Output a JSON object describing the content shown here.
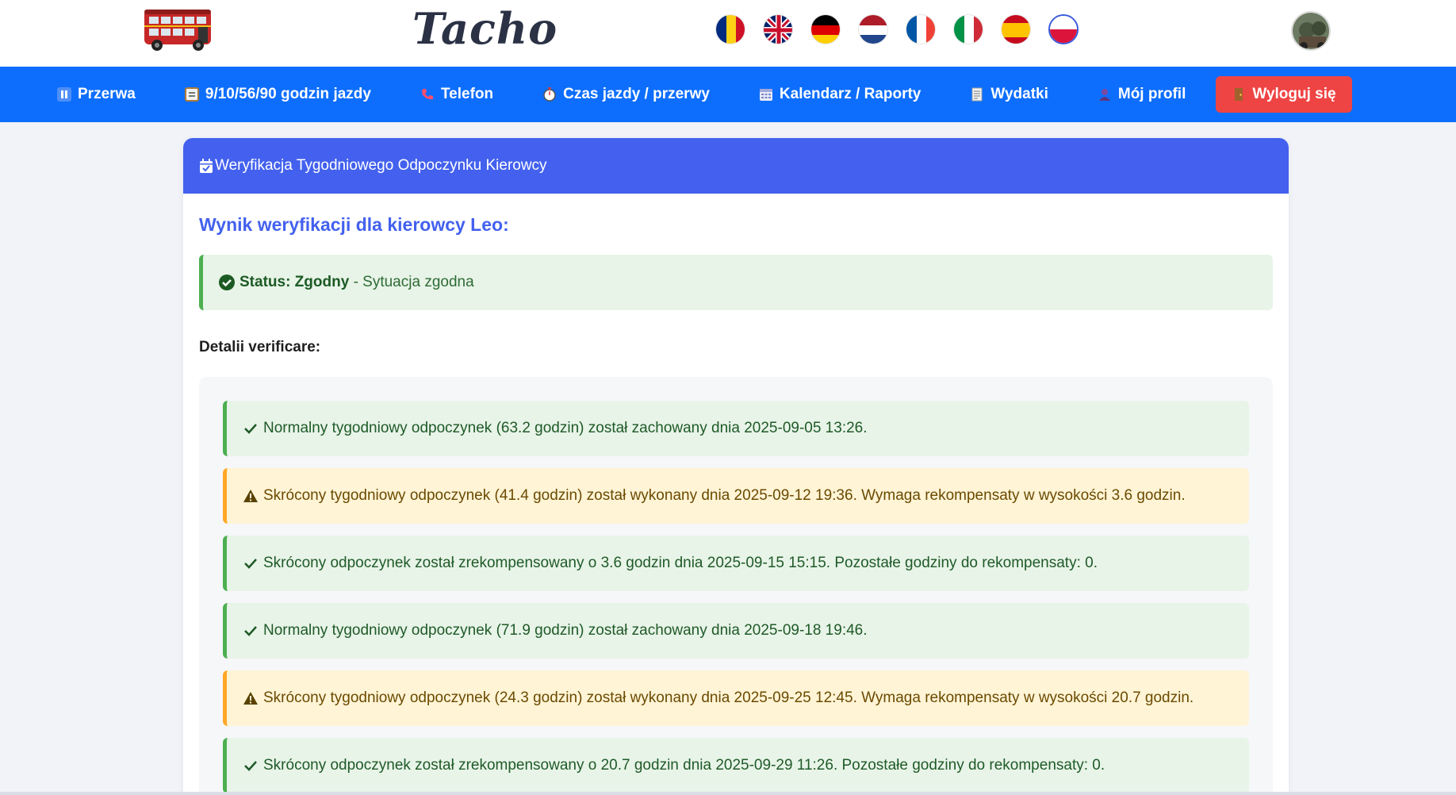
{
  "header": {
    "brand": "Tacho",
    "logo_icon": "double-decker-bus-icon",
    "flags": [
      {
        "name": "flag-romania-icon"
      },
      {
        "name": "flag-uk-icon"
      },
      {
        "name": "flag-germany-icon"
      },
      {
        "name": "flag-netherlands-icon"
      },
      {
        "name": "flag-france-icon"
      },
      {
        "name": "flag-italy-icon"
      },
      {
        "name": "flag-spain-icon"
      },
      {
        "name": "flag-poland-icon"
      }
    ],
    "avatar_icon": "user-avatar"
  },
  "nav": {
    "items": [
      {
        "label": "Przerwa",
        "icon": "pause-icon"
      },
      {
        "label": "9/10/56/90 godzin jazdy",
        "icon": "clipboard-icon"
      },
      {
        "label": "Telefon",
        "icon": "phone-icon"
      },
      {
        "label": "Czas jazdy / przerwy",
        "icon": "stopwatch-icon"
      },
      {
        "label": "Kalendarz / Raporty",
        "icon": "calendar-icon"
      },
      {
        "label": "Wydatki",
        "icon": "receipt-icon"
      },
      {
        "label": "Mój profil",
        "icon": "user-icon"
      }
    ],
    "logout": {
      "label": "Wyloguj się",
      "icon": "door-icon"
    }
  },
  "card": {
    "header_title": "Weryfikacja Tygodniowego Odpoczynku Kierowcy",
    "result_title": "Wynik weryfikacji dla kierowcy Leo:",
    "status_label": "Status: Zgodny",
    "status_text": "- Sytuacja zgodna",
    "details_title": "Detalii verificare:",
    "entries": [
      {
        "type": "ok",
        "text": "Normalny tygodniowy odpoczynek (63.2 godzin) został zachowany dnia 2025-09-05 13:26."
      },
      {
        "type": "warn",
        "text": "Skrócony tygodniowy odpoczynek (41.4 godzin) został wykonany dnia 2025-09-12 19:36. Wymaga rekompensaty w wysokości 3.6 godzin."
      },
      {
        "type": "ok",
        "text": "Skrócony odpoczynek został zrekompensowany o 3.6 godzin dnia 2025-09-15 15:15. Pozostałe godziny do rekompensaty: 0."
      },
      {
        "type": "ok",
        "text": "Normalny tygodniowy odpoczynek (71.9 godzin) został zachowany dnia 2025-09-18 19:46."
      },
      {
        "type": "warn",
        "text": "Skrócony tygodniowy odpoczynek (24.3 godzin) został wykonany dnia 2025-09-25 12:45. Wymaga rekompensaty w wysokości 20.7 godzin."
      },
      {
        "type": "ok",
        "text": "Skrócony odpoczynek został zrekompensowany o 20.7 godzin dnia 2025-09-29 11:26. Pozostałe godziny do rekompensaty: 0."
      }
    ]
  },
  "colors": {
    "nav_bg": "#0d6efd",
    "card_header_bg": "#4361ee",
    "logout_bg": "#ef4444",
    "ok_border": "#4caf50",
    "warn_border": "#ffa726"
  }
}
